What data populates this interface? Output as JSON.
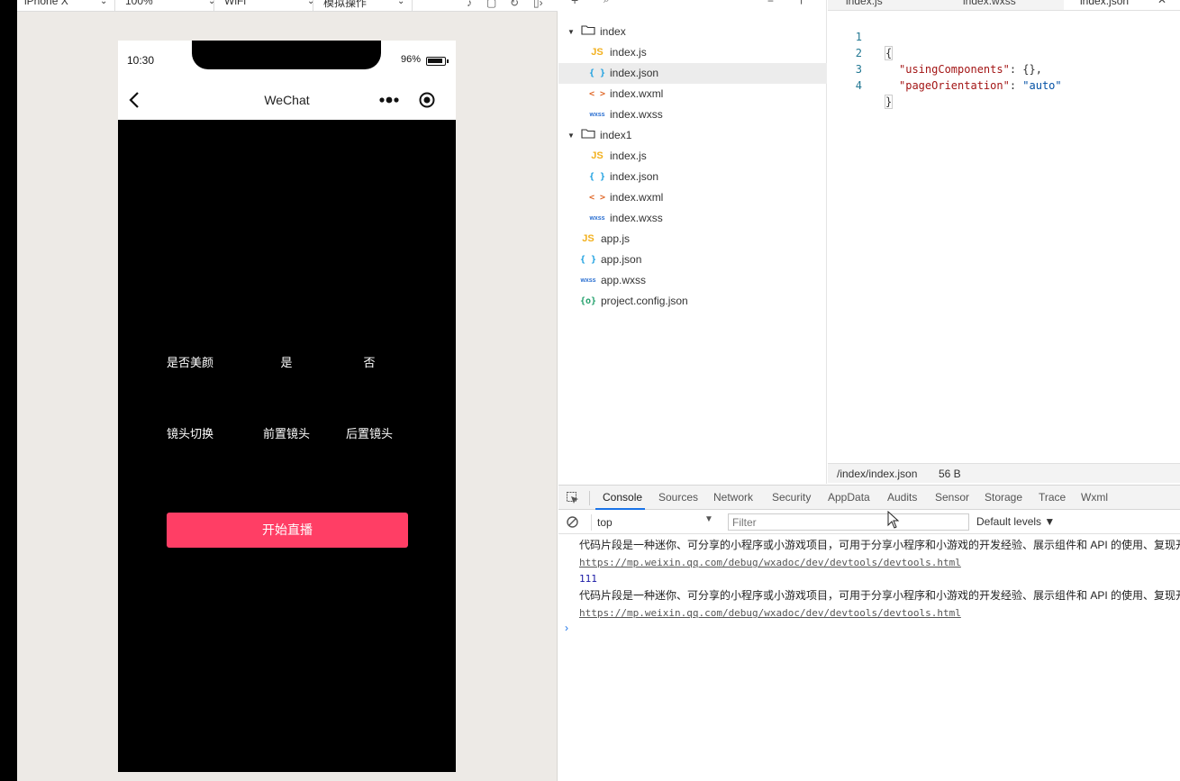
{
  "simulator": {
    "toolbar": {
      "device": "iPhone X",
      "zoom": "100%",
      "network": "WiFi",
      "operation": "模拟操作"
    },
    "status_bar": {
      "time": "10:30",
      "battery": "96%"
    },
    "navbar": {
      "title": "WeChat"
    },
    "page": {
      "beauty_label": "是否美颜",
      "beauty_yes": "是",
      "beauty_no": "否",
      "camera_label": "镜头切换",
      "camera_front": "前置镜头",
      "camera_back": "后置镜头",
      "start_button": "开始直播"
    }
  },
  "file_tree": {
    "items": [
      {
        "label": "index",
        "type": "folder"
      },
      {
        "label": "index.js",
        "type": "js"
      },
      {
        "label": "index.json",
        "type": "json",
        "selected": true
      },
      {
        "label": "index.wxml",
        "type": "wxml"
      },
      {
        "label": "index.wxss",
        "type": "wxss"
      },
      {
        "label": "index1",
        "type": "folder"
      },
      {
        "label": "index.js",
        "type": "js"
      },
      {
        "label": "index.json",
        "type": "json"
      },
      {
        "label": "index.wxml",
        "type": "wxml"
      },
      {
        "label": "index.wxss",
        "type": "wxss"
      },
      {
        "label": "app.js",
        "type": "js"
      },
      {
        "label": "app.json",
        "type": "json"
      },
      {
        "label": "app.wxss",
        "type": "wxss"
      },
      {
        "label": "project.config.json",
        "type": "config"
      }
    ]
  },
  "editor": {
    "tabs": [
      "index.js",
      "index.wxss",
      "index.json"
    ],
    "active_tab": "index.json",
    "lines": [
      {
        "num": "1",
        "text": "{"
      },
      {
        "num": "2",
        "key": "\"usingComponents\"",
        "value": "{},"
      },
      {
        "num": "3",
        "key": "\"pageOrientation\"",
        "value": "\"auto\""
      },
      {
        "num": "4",
        "text": "}"
      }
    ],
    "status": {
      "path": "/index/index.json",
      "size": "56 B"
    }
  },
  "devtools": {
    "tabs": [
      "Console",
      "Sources",
      "Network",
      "Security",
      "AppData",
      "Audits",
      "Sensor",
      "Storage",
      "Trace",
      "Wxml"
    ],
    "active_tab": "Console",
    "context": "top",
    "filter_placeholder": "Filter",
    "levels": "Default levels ▼",
    "messages": [
      {
        "text": "代码片段是一种迷你、可分享的小程序或小游戏项目，可用于分享小程序和小游戏的开发经验、展示组件和 API 的使用、复现开发问题和 Bug 等。"
      },
      {
        "link": "https://mp.weixin.qq.com/debug/wxadoc/dev/devtools/devtools.html"
      },
      {
        "number": "111"
      },
      {
        "text": "代码片段是一种迷你、可分享的小程序或小游戏项目，可用于分享小程序和小游戏的开发经验、展示组件和 API 的使用、复现开发问题和 Bug 等。"
      },
      {
        "link": "https://mp.weixin.qq.com/debug/wxadoc/dev/devtools/devtools.html"
      }
    ],
    "prompt": "›"
  },
  "colors": {
    "accent_button": "#ff3e65",
    "console_link": "#555555",
    "active_tab_underline": "#1a73e8"
  }
}
